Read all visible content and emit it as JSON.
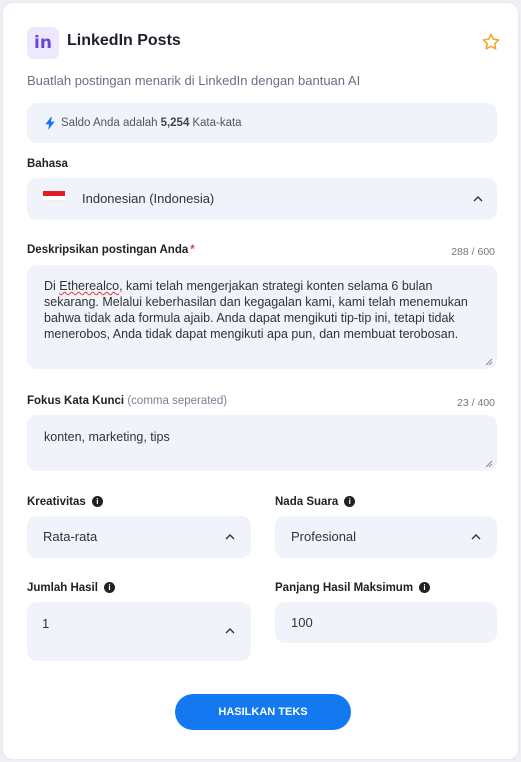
{
  "header": {
    "logo_text": "in",
    "title": "LinkedIn Posts",
    "subtitle": "Buatlah postingan menarik di LinkedIn dengan bantuan AI",
    "favorite_icon": "star-icon"
  },
  "balance": {
    "prefix": "Saldo Anda adalah",
    "amount": "5,254",
    "suffix": "Kata-kata",
    "icon": "lightning-icon"
  },
  "language": {
    "label": "Bahasa",
    "value": "Indonesian (Indonesia)",
    "flag": "indonesia-flag"
  },
  "description": {
    "label": "Deskripsikan postingan Anda",
    "required_mark": "*",
    "counter": "288 / 600",
    "value_first_word": "Di",
    "value_misspelled": "Etherealco",
    "value_line1_rest": ", kami telah mengerjakan strategi konten selama 6 bulan",
    "value_rest": "sekarang. Melalui keberhasilan dan kegagalan kami, kami telah menemukan bahwa tidak ada formula ajaib. Anda dapat mengikuti tip-tip ini, tetapi tidak menerobos, Anda tidak dapat mengikuti apa pun, dan membuat terobosan."
  },
  "keywords": {
    "label": "Fokus Kata Kunci",
    "hint": "(comma seperated)",
    "counter": "23 / 400",
    "value": "konten, marketing, tips"
  },
  "creativity": {
    "label": "Kreativitas",
    "value": "Rata-rata"
  },
  "tone": {
    "label": "Nada Suara",
    "value": "Profesional"
  },
  "results": {
    "label": "Jumlah Hasil",
    "value": "1"
  },
  "max_length": {
    "label": "Panjang Hasil Maksimum",
    "value": "100"
  },
  "submit": {
    "label": "HASILKAN TEKS"
  },
  "colors": {
    "accent": "#1479f0",
    "field_bg": "#f0f3f9",
    "logo_bg": "#ede8fb",
    "logo_fg": "#6b47d8",
    "star": "#f5a623",
    "required": "#e23c3c"
  }
}
